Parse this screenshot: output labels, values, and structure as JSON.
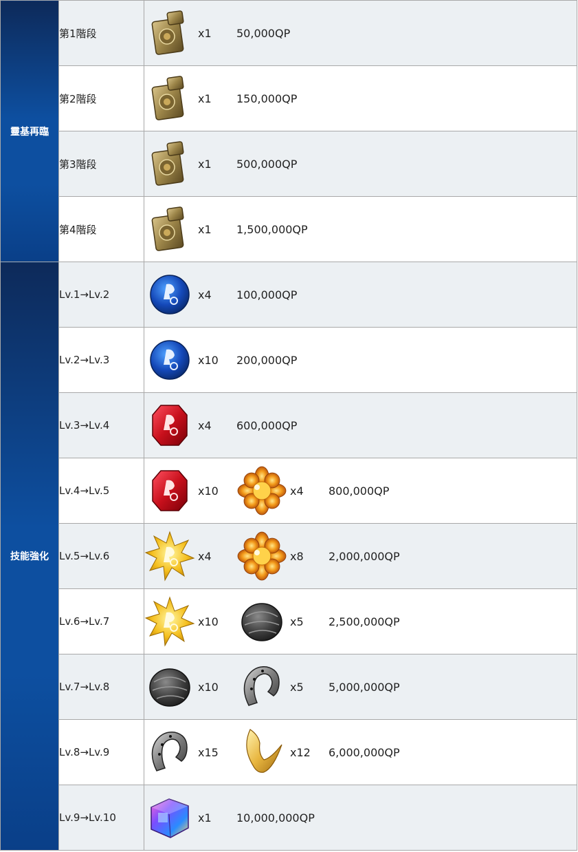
{
  "groups": [
    {
      "label": "靈基再臨",
      "rows": [
        {
          "stage": "第1階段",
          "items": [
            {
              "icon": "lighter-icon",
              "qty": "x1"
            }
          ],
          "qp": "50,000QP"
        },
        {
          "stage": "第2階段",
          "items": [
            {
              "icon": "lighter-icon",
              "qty": "x1"
            }
          ],
          "qp": "150,000QP"
        },
        {
          "stage": "第3階段",
          "items": [
            {
              "icon": "lighter-icon",
              "qty": "x1"
            }
          ],
          "qp": "500,000QP"
        },
        {
          "stage": "第4階段",
          "items": [
            {
              "icon": "lighter-icon",
              "qty": "x1"
            }
          ],
          "qp": "1,500,000QP"
        }
      ]
    },
    {
      "label": "技能強化",
      "rows": [
        {
          "stage": "Lv.1→Lv.2",
          "items": [
            {
              "icon": "blue-gem-icon",
              "qty": "x4"
            }
          ],
          "qp": "100,000QP"
        },
        {
          "stage": "Lv.2→Lv.3",
          "items": [
            {
              "icon": "blue-gem-icon",
              "qty": "x10"
            }
          ],
          "qp": "200,000QP"
        },
        {
          "stage": "Lv.3→Lv.4",
          "items": [
            {
              "icon": "red-gem-icon",
              "qty": "x4"
            }
          ],
          "qp": "600,000QP"
        },
        {
          "stage": "Lv.4→Lv.5",
          "items": [
            {
              "icon": "red-gem-icon",
              "qty": "x10"
            },
            {
              "icon": "orange-flower-icon",
              "qty": "x4"
            }
          ],
          "qp": "800,000QP"
        },
        {
          "stage": "Lv.5→Lv.6",
          "items": [
            {
              "icon": "gold-star-gem-icon",
              "qty": "x4"
            },
            {
              "icon": "orange-flower-icon",
              "qty": "x8"
            }
          ],
          "qp": "2,000,000QP"
        },
        {
          "stage": "Lv.6→Lv.7",
          "items": [
            {
              "icon": "gold-star-gem-icon",
              "qty": "x10"
            },
            {
              "icon": "dark-seed-icon",
              "qty": "x5"
            }
          ],
          "qp": "2,500,000QP"
        },
        {
          "stage": "Lv.7→Lv.8",
          "items": [
            {
              "icon": "dark-seed-icon",
              "qty": "x10"
            },
            {
              "icon": "horseshoe-icon",
              "qty": "x5"
            }
          ],
          "qp": "5,000,000QP"
        },
        {
          "stage": "Lv.8→Lv.9",
          "items": [
            {
              "icon": "horseshoe-icon",
              "qty": "x15"
            },
            {
              "icon": "golden-claw-icon",
              "qty": "x12"
            }
          ],
          "qp": "6,000,000QP"
        },
        {
          "stage": "Lv.9→Lv.10",
          "items": [
            {
              "icon": "crystal-cube-icon",
              "qty": "x1"
            }
          ],
          "qp": "10,000,000QP"
        }
      ]
    }
  ]
}
